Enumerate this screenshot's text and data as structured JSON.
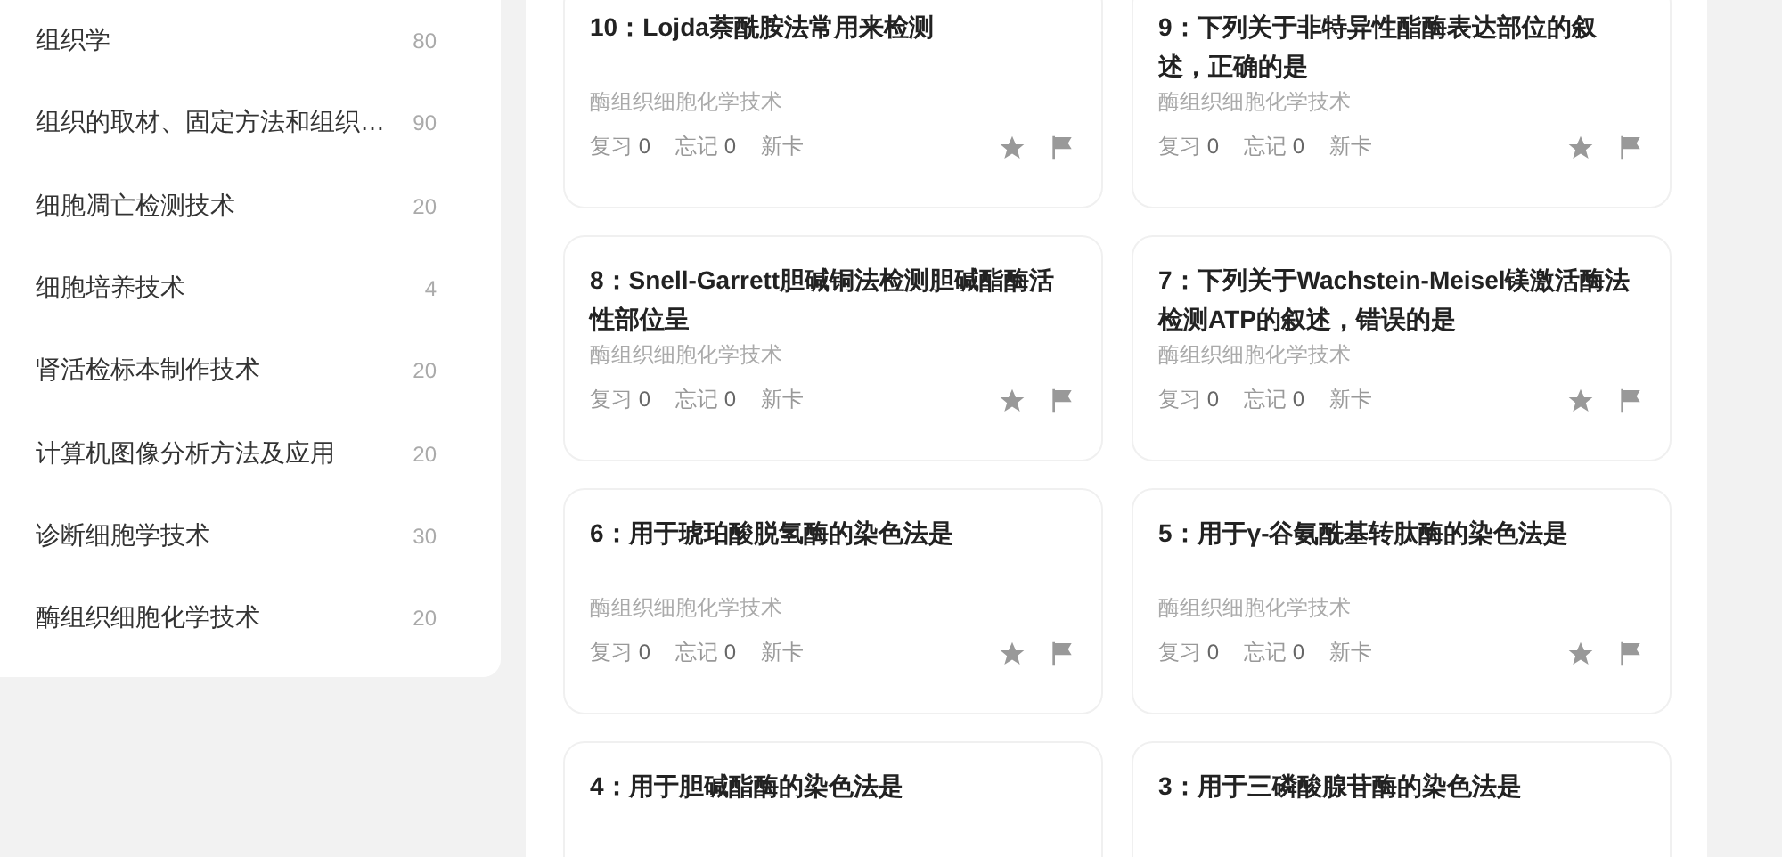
{
  "sidebar": {
    "items": [
      {
        "label": "组织学",
        "count": "80"
      },
      {
        "label": "组织的取材、固定方法和组织…",
        "count": "90"
      },
      {
        "label": "细胞凋亡检测技术",
        "count": "20"
      },
      {
        "label": "细胞培养技术",
        "count": "4"
      },
      {
        "label": "肾活检标本制作技术",
        "count": "20"
      },
      {
        "label": "计算机图像分析方法及应用",
        "count": "20"
      },
      {
        "label": "诊断细胞学技术",
        "count": "30"
      },
      {
        "label": "酶组织细胞化学技术",
        "count": "20"
      }
    ]
  },
  "cards": [
    {
      "title": "10：Lojda萘酰胺法常用来检测",
      "category": "酶组织细胞化学技术",
      "review_label": "复习",
      "review": "0",
      "forget_label": "忘记",
      "forget": "0",
      "status": "新卡"
    },
    {
      "title": "9：下列关于非特异性酯酶表达部位的叙述，正确的是",
      "category": "酶组织细胞化学技术",
      "review_label": "复习",
      "review": "0",
      "forget_label": "忘记",
      "forget": "0",
      "status": "新卡"
    },
    {
      "title": "8：Snell-Garrett胆碱铜法检测胆碱酯酶活性部位呈",
      "category": "酶组织细胞化学技术",
      "review_label": "复习",
      "review": "0",
      "forget_label": "忘记",
      "forget": "0",
      "status": "新卡"
    },
    {
      "title": "7：下列关于Wachstein-Meisel镁激活酶法检测ATP的叙述，错误的是",
      "category": "酶组织细胞化学技术",
      "review_label": "复习",
      "review": "0",
      "forget_label": "忘记",
      "forget": "0",
      "status": "新卡"
    },
    {
      "title": "6：用于琥珀酸脱氢酶的染色法是",
      "category": "酶组织细胞化学技术",
      "review_label": "复习",
      "review": "0",
      "forget_label": "忘记",
      "forget": "0",
      "status": "新卡"
    },
    {
      "title": "5：用于γ-谷氨酰基转肽酶的染色法是",
      "category": "酶组织细胞化学技术",
      "review_label": "复习",
      "review": "0",
      "forget_label": "忘记",
      "forget": "0",
      "status": "新卡"
    },
    {
      "title": "4：用于胆碱酯酶的染色法是"
    },
    {
      "title": "3：用于三磷酸腺苷酶的染色法是"
    }
  ]
}
